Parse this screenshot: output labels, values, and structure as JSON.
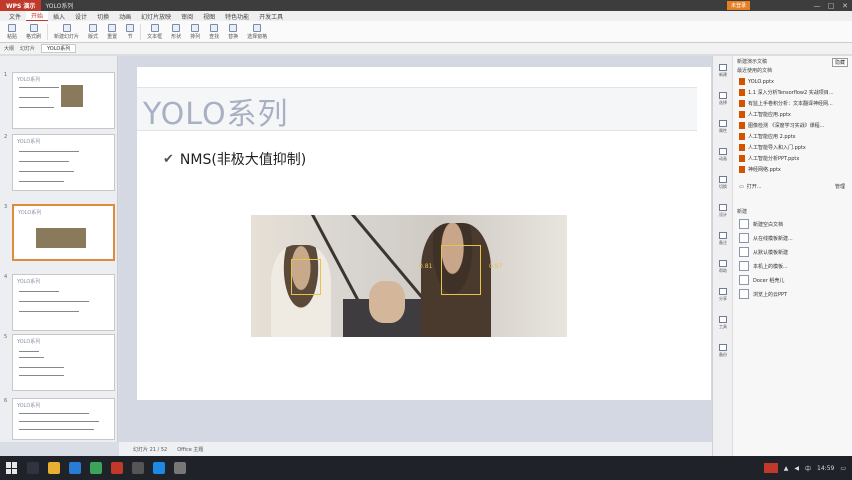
{
  "titlebar": {
    "app_name": "WPS 演示",
    "doc_name": "YOLO系列",
    "login": "未登录",
    "min": "—",
    "max": "□",
    "close": "✕"
  },
  "menu": {
    "tabs": [
      "文件",
      "开始",
      "插入",
      "设计",
      "切换",
      "动画",
      "幻灯片放映",
      "审阅",
      "视图",
      "特色功能",
      "开发工具"
    ],
    "active_index": 1
  },
  "ribbon": {
    "buttons": [
      "粘贴",
      "格式刷",
      "新建幻灯片",
      "版式",
      "重置",
      "节",
      "文本框",
      "形状",
      "排列",
      "查找",
      "替换",
      "选择窗格"
    ]
  },
  "quickbar": {
    "items": [
      "大纲",
      "幻灯片"
    ],
    "file_tab": "YOLO系列"
  },
  "thumbnails": [
    {
      "num": "1",
      "title": "YOLO系列"
    },
    {
      "num": "2",
      "title": "YOLO系列"
    },
    {
      "num": "3",
      "title": "YOLO系列"
    },
    {
      "num": "4",
      "title": "YOLO系列"
    },
    {
      "num": "5",
      "title": "YOLO系列"
    },
    {
      "num": "6",
      "title": "YOLO系列"
    }
  ],
  "slide": {
    "title": "YOLO系列",
    "bullet": "NMS(非极大值抑制)",
    "scores": [
      "0.81",
      "0.97"
    ]
  },
  "statusbar": {
    "slide_info": "幻灯片 21 / 52",
    "theme": "Office 主题"
  },
  "rightpanel": {
    "header": "新建演示文稿",
    "close_label": "隐藏",
    "recent_title": "最近使用的文档",
    "recent_files": [
      "YOLO.pptx",
      "1.1 深入分析Tensorflow2 实战项目...",
      "有监上手卷积分析：文本翻译神经网...",
      "人工智能应用.pptx",
      "图像检测  《深度学习实战》课程...",
      "人工智能应用 2.pptx",
      "人工智能导入和入门.pptx",
      "人工智能分析PPT.pptx",
      "神经网络.pptx"
    ],
    "open_label": "打开...",
    "manage_label": "管理",
    "new_title": "新建",
    "new_items": [
      "新建空白文档",
      "从在线模板新建...",
      "从默认模板新建",
      "本机上的模板...",
      "Docer 稻壳儿",
      "浏览上的云PPT"
    ],
    "side_icons": [
      "新建",
      "选择",
      "属性",
      "动画",
      "切换",
      "设计",
      "备注",
      "帮助",
      "分享",
      "工具",
      "备份"
    ]
  },
  "taskbar": {
    "time": "14:59",
    "lang": "中"
  }
}
